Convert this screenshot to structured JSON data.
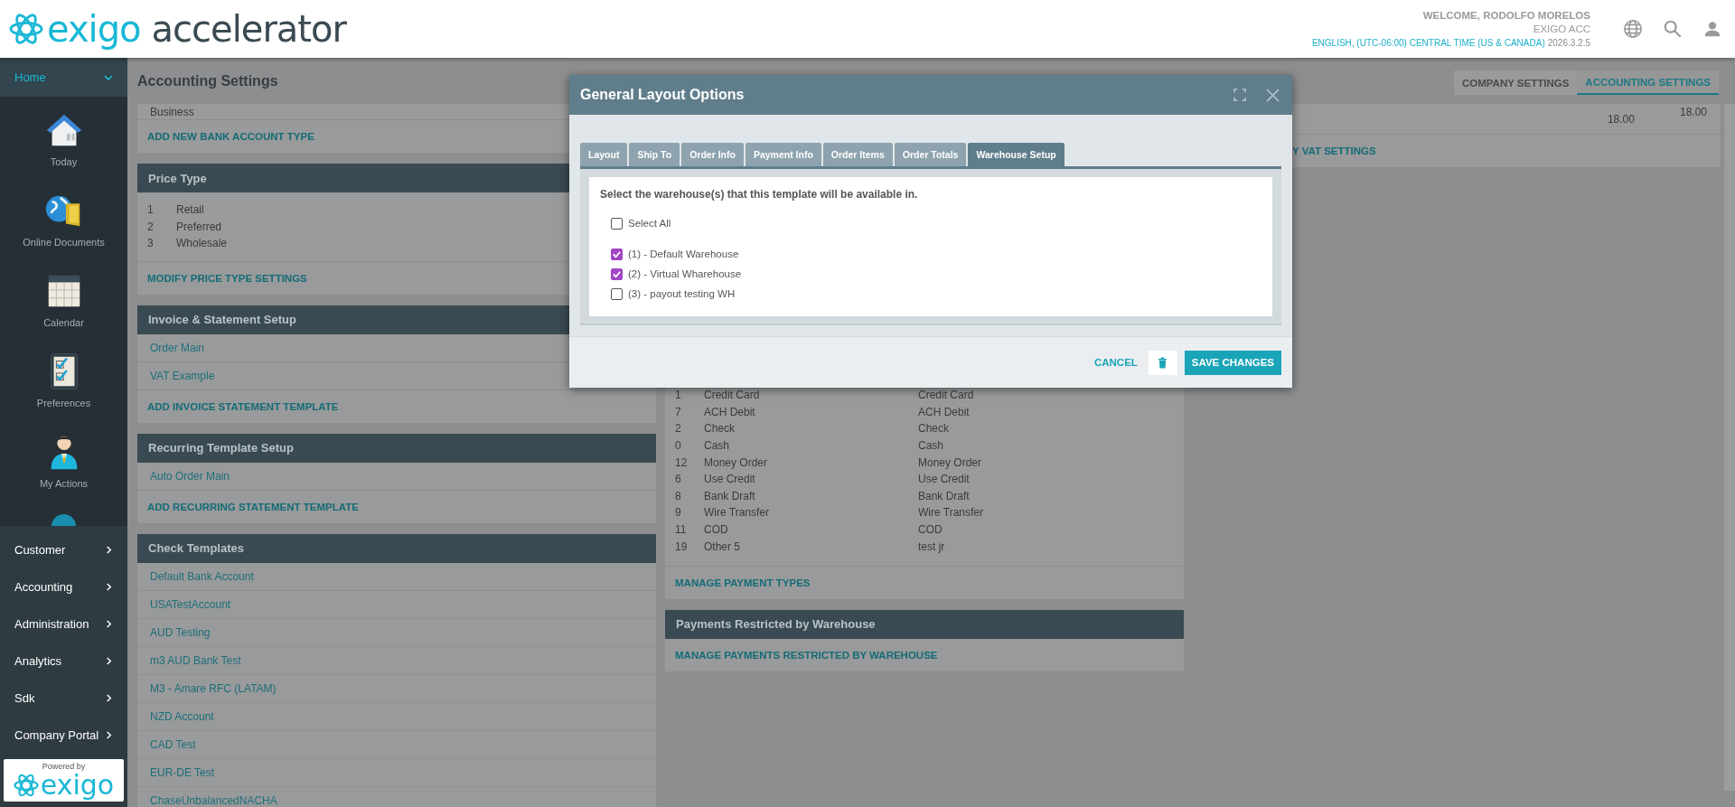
{
  "header": {
    "logo_brand": "exigo",
    "logo_product": "accelerator",
    "welcome": "WELCOME, RODOLFO MORELOS",
    "company": "EXIGO ACC",
    "locale": "ENGLISH, (UTC-06:00) CENTRAL TIME (US & CANADA)",
    "version": "2026.3.2.5"
  },
  "sidebar": {
    "home": {
      "label": "Home",
      "expanded": true
    },
    "shortcuts": [
      {
        "label": "Today"
      },
      {
        "label": "Online Documents"
      },
      {
        "label": "Calendar"
      },
      {
        "label": "Preferences"
      },
      {
        "label": "My Actions"
      }
    ],
    "menu": [
      {
        "label": "Customer"
      },
      {
        "label": "Accounting"
      },
      {
        "label": "Administration"
      },
      {
        "label": "Analytics"
      },
      {
        "label": "Sdk"
      },
      {
        "label": "Company Portal"
      }
    ],
    "powered_by": {
      "caption": "Powered by",
      "brand": "exigo"
    }
  },
  "page_title": "Accounting Settings",
  "page_tabs": [
    {
      "label": "COMPANY SETTINGS",
      "selected": false
    },
    {
      "label": "ACCOUNTING SETTINGS",
      "selected": true
    }
  ],
  "left_sections": [
    {
      "rows": [
        {
          "label": "Business"
        }
      ],
      "link": "ADD NEW BANK ACCOUNT TYPE"
    },
    {
      "title": "Price Type",
      "numbered_rows": [
        {
          "number": "1",
          "name": "Retail"
        },
        {
          "number": "2",
          "name": "Preferred"
        },
        {
          "number": "3",
          "name": "Wholesale"
        }
      ],
      "link": "MODIFY PRICE TYPE SETTINGS"
    },
    {
      "title": "Invoice & Statement Setup",
      "item_links": [
        "Order Main",
        "VAT Example"
      ],
      "link": "ADD INVOICE STATEMENT TEMPLATE"
    },
    {
      "title": "Recurring Template Setup",
      "item_links": [
        "Auto Order Main"
      ],
      "link": "ADD RECURRING STATEMENT TEMPLATE"
    },
    {
      "title": "Check Templates",
      "item_links": [
        "Default Bank Account",
        "USATestAccount",
        "AUD Testing",
        "m3 AUD Bank Test",
        "M3 - Amare RFC (LATAM)",
        "NZD Account",
        "CAD Test",
        "EUR-DE Test",
        "ChaseUnbalancedNACHA"
      ]
    }
  ],
  "payment_types": {
    "rows": [
      {
        "id": "1",
        "name": "Credit Card",
        "display": "Credit Card"
      },
      {
        "id": "7",
        "name": "ACH Debit",
        "display": "ACH Debit"
      },
      {
        "id": "2",
        "name": "Check",
        "display": "Check"
      },
      {
        "id": "0",
        "name": "Cash",
        "display": "Cash"
      },
      {
        "id": "12",
        "name": "Money Order",
        "display": "Money Order"
      },
      {
        "id": "6",
        "name": "Use Credit",
        "display": "Use Credit"
      },
      {
        "id": "8",
        "name": "Bank Draft",
        "display": "Bank Draft"
      },
      {
        "id": "9",
        "name": "Wire Transfer",
        "display": "Wire Transfer"
      },
      {
        "id": "11",
        "name": "COD",
        "display": "COD"
      },
      {
        "id": "19",
        "name": "Other 5",
        "display": "test jr"
      }
    ],
    "link": "MANAGE PAYMENT TYPES"
  },
  "payments_restricted": {
    "title": "Payments Restricted by Warehouse",
    "link": "MANAGE PAYMENTS RESTRICTED BY WAREHOUSE"
  },
  "vat": {
    "rows": [
      {
        "column_1": "18.00",
        "column_2": "18.00"
      }
    ],
    "link": "Y VAT SETTINGS"
  },
  "modal": {
    "title": "General Layout Options",
    "tabs": [
      {
        "label": "Layout",
        "selected": false
      },
      {
        "label": "Ship To",
        "selected": false
      },
      {
        "label": "Order Info",
        "selected": false
      },
      {
        "label": "Payment Info",
        "selected": false
      },
      {
        "label": "Order Items",
        "selected": false
      },
      {
        "label": "Order Totals",
        "selected": false
      },
      {
        "label": "Warehouse Setup",
        "selected": true
      }
    ],
    "prompt": "Select the warehouse(s) that this template will be available in.",
    "select_all": {
      "label": "Select All",
      "checked": false
    },
    "warehouses": [
      {
        "label": "(1) - Default Warehouse",
        "checked": true
      },
      {
        "label": "(2) - Virtual Wharehouse",
        "checked": true
      },
      {
        "label": "(3) - payout testing WH",
        "checked": false
      }
    ],
    "cancel": "CANCEL",
    "save": "SAVE CHANGES"
  }
}
